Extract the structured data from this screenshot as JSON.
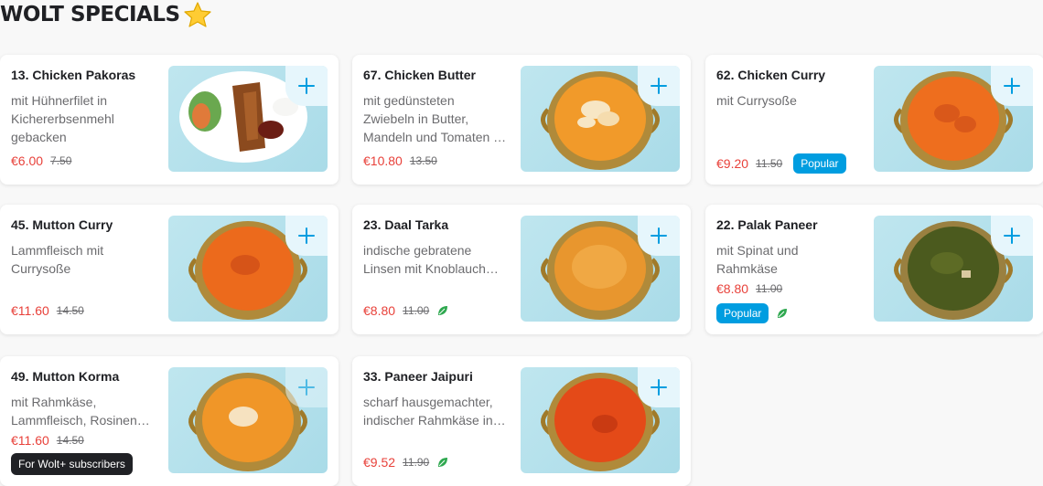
{
  "section": {
    "title": "WOLT SPECIALS",
    "icon": "star-icon"
  },
  "colors": {
    "accent": "#009de0",
    "price": "#e8413a",
    "veg": "#2ea84f"
  },
  "items": [
    {
      "name": "13. Chicken Pakoras",
      "desc": "mit Hühnerfilet in Kichererbsenmehl gebacken",
      "price": "€6.00",
      "old": "7.50",
      "popular": false,
      "veg": false,
      "food": "pakora-plate"
    },
    {
      "name": "67. Chicken Butter",
      "desc": "mit gedünsteten Zwiebeln in Butter, Mandeln und Tomaten …",
      "price": "€10.80",
      "old": "13.50",
      "popular": false,
      "veg": false,
      "food": "butter-chicken-bowl"
    },
    {
      "name": "62. Chicken Curry",
      "desc": "mit Currysoße",
      "price": "€9.20",
      "old": "11.50",
      "popular": true,
      "veg": false,
      "food": "chicken-curry-bowl"
    },
    {
      "name": "45. Mutton Curry",
      "desc": "Lammfleisch mit Currysoße",
      "price": "€11.60",
      "old": "14.50",
      "popular": false,
      "veg": false,
      "food": "mutton-curry-bowl"
    },
    {
      "name": "23. Daal Tarka",
      "desc": "indische gebratene Linsen mit Knoblauch…",
      "price": "€8.80",
      "old": "11.00",
      "popular": false,
      "veg": true,
      "food": "daal-bowl"
    },
    {
      "name": "22. Palak Paneer",
      "desc": "mit Spinat und Rahmkäse",
      "price": "€8.80",
      "old": "11.00",
      "popular": true,
      "veg": true,
      "food": "palak-paneer-bowl"
    },
    {
      "name": "49. Mutton Korma",
      "desc": "mit Rahmkäse, Lammfleisch, Rosinen…",
      "price": "€11.60",
      "old": "14.50",
      "popular": false,
      "veg": false,
      "tag": "For Wolt+ subscribers",
      "food": "korma-bowl"
    },
    {
      "name": "33. Paneer Jaipuri",
      "desc": "scharf hausgemachter, indischer Rahmkäse in…",
      "price": "€9.52",
      "old": "11.90",
      "popular": false,
      "veg": true,
      "food": "paneer-jaipuri-bowl"
    }
  ],
  "labels": {
    "popular": "Popular"
  }
}
